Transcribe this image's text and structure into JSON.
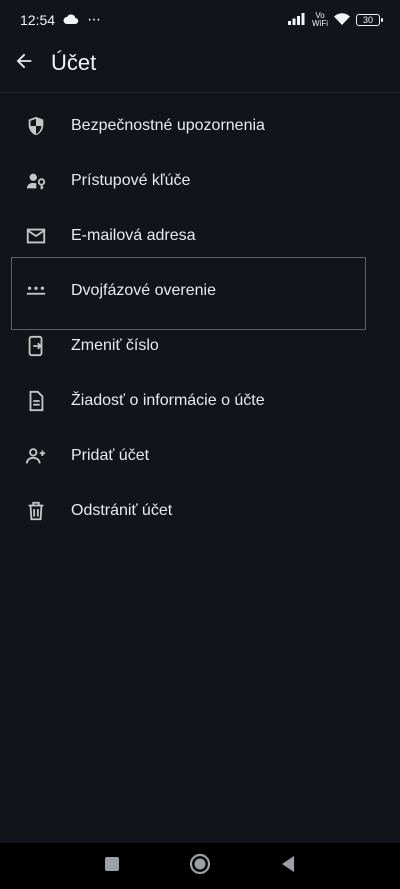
{
  "status_bar": {
    "time": "12:54",
    "notification_dots": "···",
    "volte_line1": "Vo",
    "volte_line2": "WiFi",
    "battery": "30"
  },
  "app_bar": {
    "title": "Účet"
  },
  "menu": {
    "items": [
      {
        "label": "Bezpečnostné upozornenia",
        "icon": "shield-icon"
      },
      {
        "label": "Prístupové kľúče",
        "icon": "passkey-icon"
      },
      {
        "label": "E-mailová adresa",
        "icon": "email-icon"
      },
      {
        "label": "Dvojfázové overenie",
        "icon": "password-dots-icon"
      },
      {
        "label": "Zmeniť číslo",
        "icon": "phone-transfer-icon"
      },
      {
        "label": "Žiadosť o informácie o účte",
        "icon": "document-icon"
      },
      {
        "label": "Pridať účet",
        "icon": "add-person-icon"
      },
      {
        "label": "Odstrániť účet",
        "icon": "trash-icon"
      }
    ]
  },
  "colors": {
    "background": "#111418",
    "text": "#e8eaed",
    "icon": "#c4c7c5",
    "highlight_border": "#c0392b"
  }
}
